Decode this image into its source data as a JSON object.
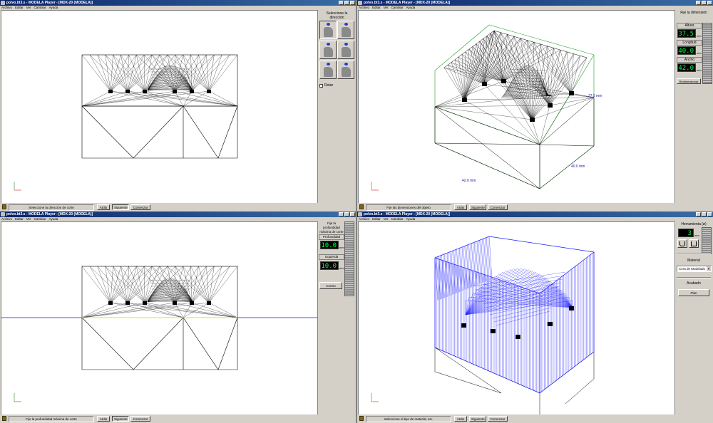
{
  "windows": {
    "tl": {
      "title": "polvo.bt3.s - MODELA Player - [MDX-20 (MODELA)]",
      "status": "Seleccione la dirección de corte",
      "buttons": [
        "Atrás",
        "Siguiente",
        "Comenzar"
      ],
      "panel": {
        "heading": "Seleccione la dirección",
        "checkbox_label": "Rotar"
      }
    },
    "tr": {
      "title": "polvo.bt3.s - MODELA Player - [MDX-20 (MODELA)]",
      "status": "Fije las dimensiones del objeto",
      "buttons": [
        "Atrás",
        "Siguiente",
        "Comenzar"
      ],
      "panel": {
        "heading": "Fije la dimensión",
        "altura_label": "Altura",
        "altura_value": "37.5",
        "longitud_label": "Longitud",
        "longitud_value": "40.0",
        "ancho_label": "Ancho",
        "ancho_value": "42.0",
        "unit": "mm",
        "bottom_button": "Redimensionar"
      },
      "annotations": {
        "height": "37.5 mm",
        "length": "40.0 mm",
        "width": "42.0 mm"
      }
    },
    "bl": {
      "title": "polvo.bt3.s - MODELA Player - [MDX-20 (MODELA)]",
      "status": "Fije la profundidad máxima de corte",
      "buttons": [
        "Atrás",
        "Siguiente",
        "Comenzar"
      ],
      "panel": {
        "heading": "Fije la profundidad máxima de corte",
        "profundidad_label": "Profundidad",
        "profundidad_value": "10.0",
        "izquierda_label": "Izquierda",
        "izquierda_value": "10.0",
        "unit": "mm",
        "centro_button": "Centro"
      }
    },
    "br": {
      "title": "polvo.bt3.s - MODELA Player - [MDX-20 (MODELA)]",
      "status": "Seleccione el tipo de material, etc.",
      "buttons": [
        "Atrás",
        "Siguiente",
        "Comenzar"
      ],
      "panel": {
        "heading": "Herramienta (ø)",
        "tool_value": "3",
        "unit": "mm",
        "material_label": "Material",
        "material_value": "Cera de Modelado",
        "acabado_label": "Acabado",
        "acabado_button": "Plan"
      }
    }
  },
  "menu": [
    "Archivo",
    "Editar",
    "Ver",
    "Cambiar",
    "Ayuda"
  ],
  "colors": {
    "titlebar": "#0a246a",
    "lcd_text": "#00ff40",
    "mesh_blue": "#1a1aff",
    "box_green": "#2aa02a"
  }
}
